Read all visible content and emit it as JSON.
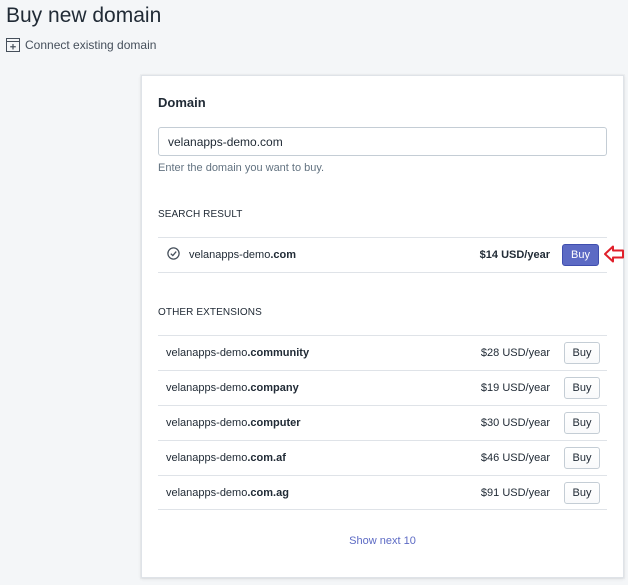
{
  "header": {
    "title": "Buy new domain",
    "connect_label": "Connect existing domain",
    "connect_icon": "add-window-icon"
  },
  "card": {
    "title": "Domain",
    "input_value": "velanapps-demo.com",
    "help_text": "Enter the domain you want to buy.",
    "search_result_heading": "SEARCH RESULT",
    "other_extensions_heading": "OTHER EXTENSIONS",
    "show_next_label": "Show next 10"
  },
  "search_result": {
    "status_icon": "check-circle-icon",
    "base": "velanapps-demo",
    "ext": ".com",
    "price": "$14 USD/year",
    "buy_label": "Buy"
  },
  "other_extensions": [
    {
      "base": "velanapps-demo",
      "ext": ".community",
      "price": "$28 USD/year",
      "buy_label": "Buy"
    },
    {
      "base": "velanapps-demo",
      "ext": ".company",
      "price": "$19 USD/year",
      "buy_label": "Buy"
    },
    {
      "base": "velanapps-demo",
      "ext": ".computer",
      "price": "$30 USD/year",
      "buy_label": "Buy"
    },
    {
      "base": "velanapps-demo",
      "ext": ".com.af",
      "price": "$46 USD/year",
      "buy_label": "Buy"
    },
    {
      "base": "velanapps-demo",
      "ext": ".com.ag",
      "price": "$91 USD/year",
      "buy_label": "Buy"
    }
  ],
  "colors": {
    "accent": "#5c6ac4",
    "annotation_arrow": "#e0202b"
  }
}
